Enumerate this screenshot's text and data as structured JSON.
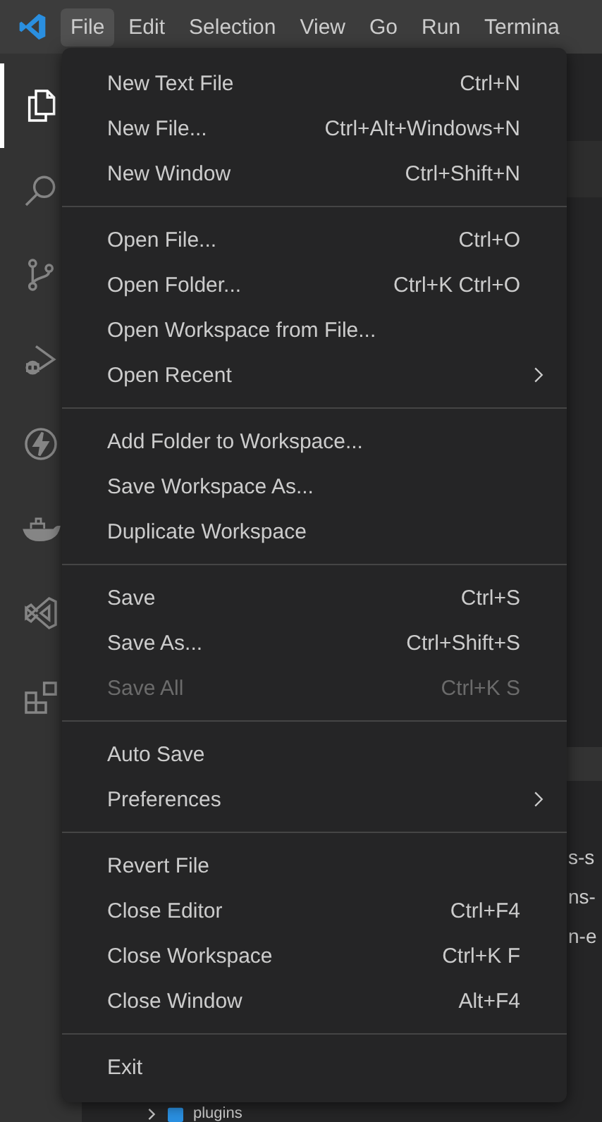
{
  "menubar": [
    {
      "label": "File",
      "selected": true
    },
    {
      "label": "Edit",
      "selected": false
    },
    {
      "label": "Selection",
      "selected": false
    },
    {
      "label": "View",
      "selected": false
    },
    {
      "label": "Go",
      "selected": false
    },
    {
      "label": "Run",
      "selected": false
    },
    {
      "label": "Termina",
      "selected": false
    }
  ],
  "activity_bar": [
    {
      "kind": "explorer",
      "selected": true
    },
    {
      "kind": "search",
      "selected": false
    },
    {
      "kind": "source-control",
      "selected": false
    },
    {
      "kind": "debug",
      "selected": false
    },
    {
      "kind": "bolt",
      "selected": false
    },
    {
      "kind": "whale",
      "selected": false
    },
    {
      "kind": "studio",
      "selected": false
    },
    {
      "kind": "extensions",
      "selected": false
    }
  ],
  "file_menu": {
    "groups": [
      [
        {
          "label": "New Text File",
          "shortcut": "Ctrl+N",
          "submenu": false,
          "disabled": false
        },
        {
          "label": "New File...",
          "shortcut": "Ctrl+Alt+Windows+N",
          "submenu": false,
          "disabled": false
        },
        {
          "label": "New Window",
          "shortcut": "Ctrl+Shift+N",
          "submenu": false,
          "disabled": false
        }
      ],
      [
        {
          "label": "Open File...",
          "shortcut": "Ctrl+O",
          "submenu": false,
          "disabled": false
        },
        {
          "label": "Open Folder...",
          "shortcut": "Ctrl+K Ctrl+O",
          "submenu": false,
          "disabled": false
        },
        {
          "label": "Open Workspace from File...",
          "submenu": false,
          "disabled": false
        },
        {
          "label": "Open Recent",
          "submenu": true,
          "disabled": false
        }
      ],
      [
        {
          "label": "Add Folder to Workspace...",
          "submenu": false,
          "disabled": false
        },
        {
          "label": "Save Workspace As...",
          "submenu": false,
          "disabled": false
        },
        {
          "label": "Duplicate Workspace",
          "submenu": false,
          "disabled": false
        }
      ],
      [
        {
          "label": "Save",
          "shortcut": "Ctrl+S",
          "submenu": false,
          "disabled": false
        },
        {
          "label": "Save As...",
          "shortcut": "Ctrl+Shift+S",
          "submenu": false,
          "disabled": false
        },
        {
          "label": "Save All",
          "shortcut": "Ctrl+K S",
          "submenu": false,
          "disabled": true
        }
      ],
      [
        {
          "label": "Auto Save",
          "submenu": false,
          "disabled": false
        },
        {
          "label": "Preferences",
          "submenu": true,
          "disabled": false
        }
      ],
      [
        {
          "label": "Revert File",
          "submenu": false,
          "disabled": false
        },
        {
          "label": "Close Editor",
          "shortcut": "Ctrl+F4",
          "submenu": false,
          "disabled": false
        },
        {
          "label": "Close Workspace",
          "shortcut": "Ctrl+K F",
          "submenu": false,
          "disabled": false
        },
        {
          "label": "Close Window",
          "shortcut": "Alt+F4",
          "submenu": false,
          "disabled": false
        }
      ],
      [
        {
          "label": "Exit",
          "submenu": false,
          "disabled": false
        }
      ]
    ]
  },
  "sidebar_rows": [
    "s-s",
    "ns-",
    "n-e"
  ],
  "tree_item": {
    "label": "plugins",
    "expanded": false
  }
}
